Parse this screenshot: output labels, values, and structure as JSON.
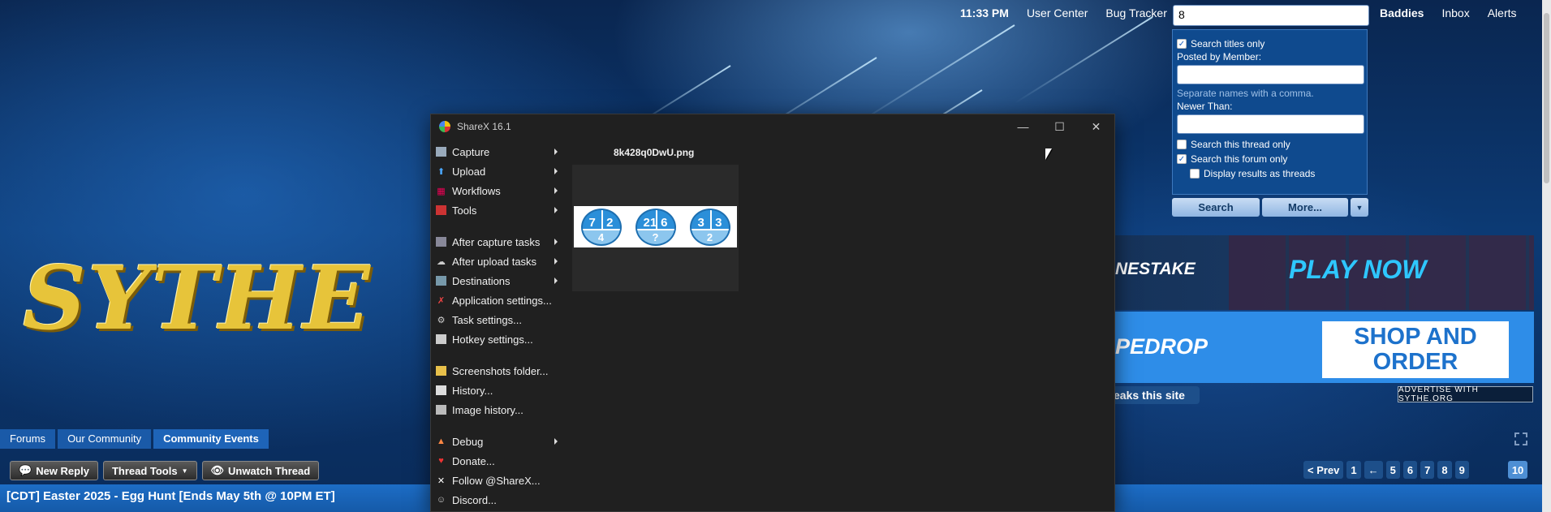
{
  "topbar": {
    "time": "11:33 PM",
    "links": [
      "User Center",
      "Bug Tracker"
    ],
    "search_value": "8",
    "user_links": [
      "Baddies",
      "Inbox",
      "Alerts"
    ]
  },
  "search_panel": {
    "titles_only": "Search titles only",
    "posted_by": "Posted by Member:",
    "separate_hint": "Separate names with a comma.",
    "newer_than": "Newer Than:",
    "this_thread": "Search this thread only",
    "this_forum": "Search this forum only",
    "as_threads": "Display results as threads",
    "search_btn": "Search",
    "more_btn": "More..."
  },
  "banners": {
    "b1_left": "NESTAKE",
    "b1_right": "PLAY NOW",
    "b2_left": "PEDROP",
    "b2_shop_line1": "SHOP AND",
    "b2_shop_line2": "ORDER",
    "advertise": "ADVERTISE WITH SYTHE.ORG",
    "leaks": "eaks this site"
  },
  "logo": {
    "text": "SYTHE"
  },
  "breadcrumb": [
    "Forums",
    "Our Community",
    "Community Events"
  ],
  "actions": {
    "new_reply": "New Reply",
    "thread_tools": "Thread Tools",
    "unwatch": "Unwatch Thread"
  },
  "thread": {
    "title": "[CDT] Easter 2025 - Egg Hunt [Ends May 5th @ 10PM ET]"
  },
  "pager": {
    "prev": "< Prev",
    "first": "1",
    "back": "←",
    "pages": [
      "5",
      "6",
      "7",
      "8",
      "9"
    ],
    "current": "10"
  },
  "sharex": {
    "title": "ShareX 16.1",
    "filename": "8k428q0DwU.png",
    "menu": [
      {
        "label": "Capture",
        "icon": "capture-icon",
        "sub": true
      },
      {
        "label": "Upload",
        "icon": "upload-icon",
        "sub": true
      },
      {
        "label": "Workflows",
        "icon": "workflows-icon",
        "sub": true
      },
      {
        "label": "Tools",
        "icon": "tools-icon",
        "sub": true
      },
      {
        "label": "After capture tasks",
        "icon": "after-capture-icon",
        "sub": true
      },
      {
        "label": "After upload tasks",
        "icon": "after-upload-icon",
        "sub": true
      },
      {
        "label": "Destinations",
        "icon": "destinations-icon",
        "sub": true
      },
      {
        "label": "Application settings...",
        "icon": "app-settings-icon",
        "sub": false
      },
      {
        "label": "Task settings...",
        "icon": "task-settings-icon",
        "sub": false
      },
      {
        "label": "Hotkey settings...",
        "icon": "hotkey-icon",
        "sub": false
      },
      {
        "label": "Screenshots folder...",
        "icon": "folder-icon",
        "sub": false
      },
      {
        "label": "History...",
        "icon": "history-icon",
        "sub": false
      },
      {
        "label": "Image history...",
        "icon": "image-history-icon",
        "sub": false
      },
      {
        "label": "Debug",
        "icon": "debug-icon",
        "sub": true
      },
      {
        "label": "Donate...",
        "icon": "heart-icon",
        "sub": false
      },
      {
        "label": "Follow @ShareX...",
        "icon": "x-icon",
        "sub": false
      },
      {
        "label": "Discord...",
        "icon": "discord-icon",
        "sub": false
      }
    ],
    "thumb_pies": [
      {
        "tl": "7",
        "tr": "2",
        "b": "4"
      },
      {
        "tl": "21",
        "tr": "6",
        "b": "?"
      },
      {
        "tl": "3",
        "tr": "3",
        "b": "2"
      }
    ]
  }
}
